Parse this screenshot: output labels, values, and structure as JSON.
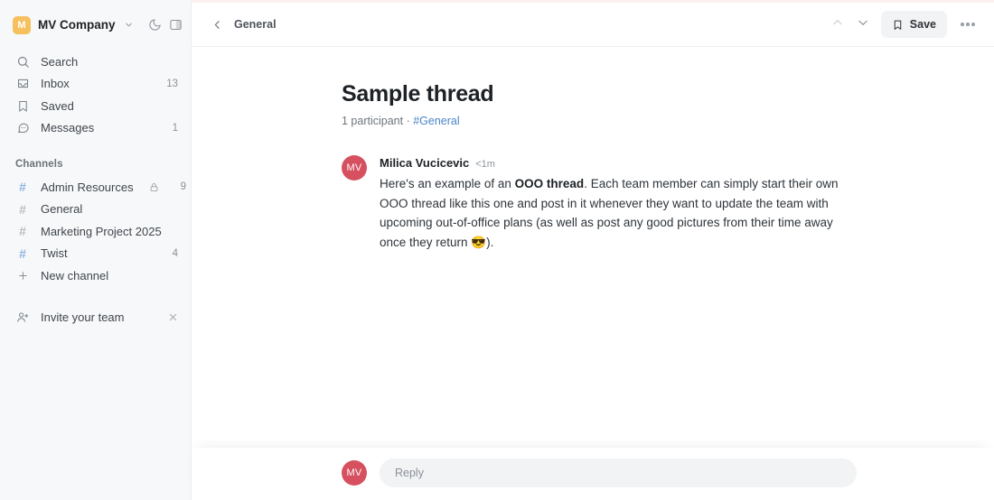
{
  "workspace": {
    "logo_letter": "M",
    "logo_color": "#f7c05e",
    "name": "MV Company",
    "caret_icon": "chevron-down-icon",
    "dark_mode_icon": "moon-icon",
    "panel_toggle_icon": "panel-toggle-icon"
  },
  "sidebar": {
    "nav": [
      {
        "label": "Search",
        "icon": "search-icon",
        "badge": ""
      },
      {
        "label": "Inbox",
        "icon": "inbox-icon",
        "badge": "13"
      },
      {
        "label": "Saved",
        "icon": "bookmark-icon",
        "badge": ""
      },
      {
        "label": "Messages",
        "icon": "message-icon",
        "badge": "1"
      }
    ],
    "channels_title": "Channels",
    "channels": [
      {
        "label": "Admin Resources",
        "badge": "9",
        "locked": true,
        "unread": true
      },
      {
        "label": "General",
        "badge": "",
        "locked": false,
        "unread": false
      },
      {
        "label": "Marketing Project 2025",
        "badge": "",
        "locked": false,
        "unread": false
      },
      {
        "label": "Twist",
        "badge": "4",
        "locked": false,
        "unread": true
      }
    ],
    "new_channel": "New channel",
    "invite": {
      "label": "Invite your team",
      "icon": "person-add-icon",
      "close_icon": "close-icon"
    },
    "unread_hash_color": "#8fb4e0"
  },
  "topbar": {
    "back_icon": "chevron-left-icon",
    "back_label": "General",
    "prev_icon": "chevron-up-icon",
    "next_icon": "chevron-down-icon",
    "save_label": "Save",
    "save_icon": "bookmark-icon",
    "more_icon": "more-horizontal-icon"
  },
  "thread": {
    "title": "Sample thread",
    "participants": "1 participant",
    "separator": " · ",
    "channel": "#General",
    "message": {
      "avatar_initials": "MV",
      "avatar_color": "#d6505f",
      "author": "Milica Vucicevic",
      "time": "<1m",
      "text_part1": "Here's an example of an ",
      "text_bold": "OOO thread",
      "text_part2": ". Each team member can simply start their own OOO thread like this one and post in it whenever they want to update the team with upcoming out-of-office plans (as well as post any good pictures from their time away once they return ",
      "emoji": "😎",
      "text_part3": ")."
    }
  },
  "composer": {
    "avatar_initials": "MV",
    "placeholder": "Reply"
  }
}
